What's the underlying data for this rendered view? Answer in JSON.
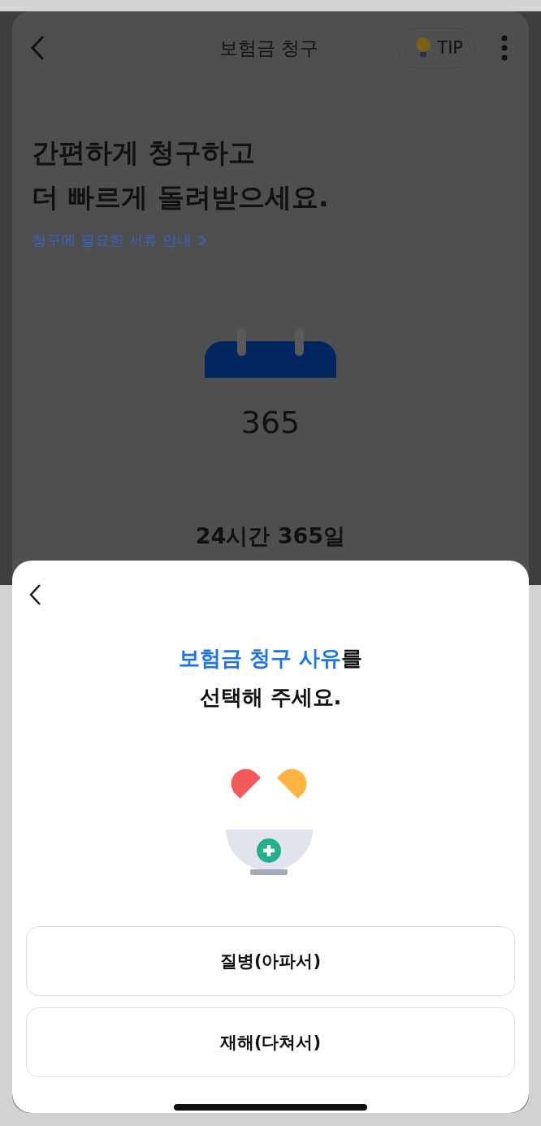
{
  "nav": {
    "title": "보험금 청구",
    "tip_label": "TIP"
  },
  "hero": {
    "heading_lines": [
      "간편하게 청구하고",
      "더 빠르게 돌려받으세요."
    ],
    "docs_link": "청구에 필요한 서류 안내",
    "calendar_number": "365",
    "caption": "24시간 365일"
  },
  "sheet": {
    "title_highlight": "보험금 청구 사유",
    "title_rest": "를",
    "title_line2": "선택해 주세요.",
    "options": [
      {
        "label": "질병(아파서)"
      },
      {
        "label": "재해(다쳐서)"
      }
    ]
  }
}
